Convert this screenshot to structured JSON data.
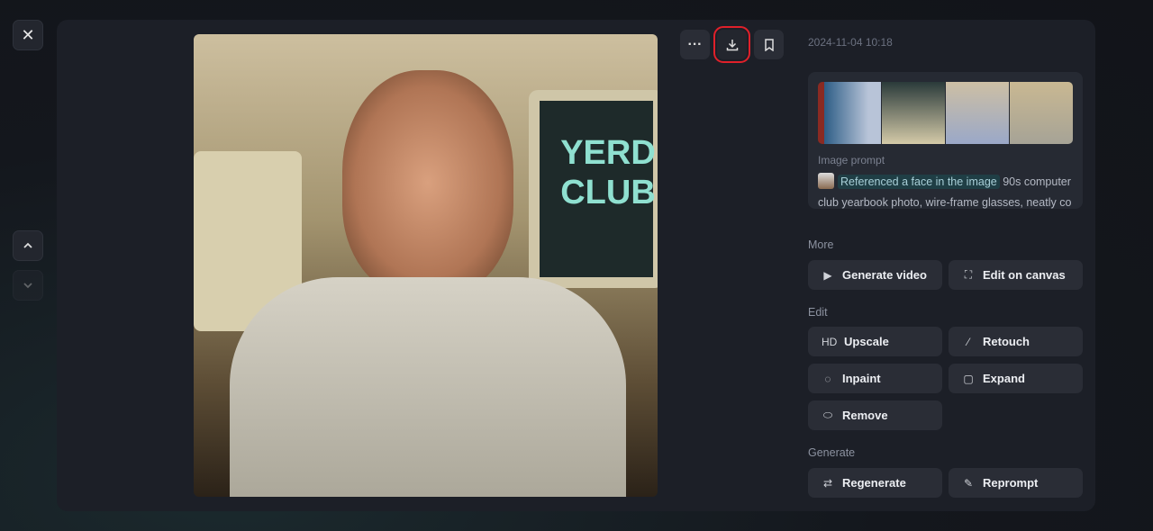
{
  "nav": {
    "close_icon": "close-icon",
    "up_icon": "chevron-up-icon",
    "down_icon": "chevron-down-icon"
  },
  "toolbar": {
    "more_icon": "more-icon",
    "download_icon": "download-icon",
    "bookmark_icon": "bookmark-icon"
  },
  "meta": {
    "date": "2024-11-04 10:18"
  },
  "prompt": {
    "label": "Image prompt",
    "chip": "Referenced a face in the image",
    "text": " 90s computer club yearbook photo, wire-frame glasses, neatly co"
  },
  "main_image": {
    "screen_text_1": "YERD",
    "screen_text_2": "CLUB"
  },
  "sections": {
    "more": {
      "title": "More",
      "buttons": [
        {
          "label": "Generate video",
          "icon": "video-plus-icon"
        },
        {
          "label": "Edit on canvas",
          "icon": "canvas-icon"
        }
      ]
    },
    "edit": {
      "title": "Edit",
      "buttons": [
        {
          "label": "Upscale",
          "icon": "HD"
        },
        {
          "label": "Retouch",
          "icon": "magic-wand-icon"
        },
        {
          "label": "Inpaint",
          "icon": "inpaint-brush-icon"
        },
        {
          "label": "Expand",
          "icon": "expand-icon"
        },
        {
          "label": "Remove",
          "icon": "eraser-icon"
        }
      ]
    },
    "generate": {
      "title": "Generate",
      "buttons": [
        {
          "label": "Regenerate",
          "icon": "repeat-icon"
        },
        {
          "label": "Reprompt",
          "icon": "pen-icon"
        }
      ]
    }
  },
  "colors": {
    "highlight": "#e0202a",
    "chip_bg": "#1f3e45"
  }
}
